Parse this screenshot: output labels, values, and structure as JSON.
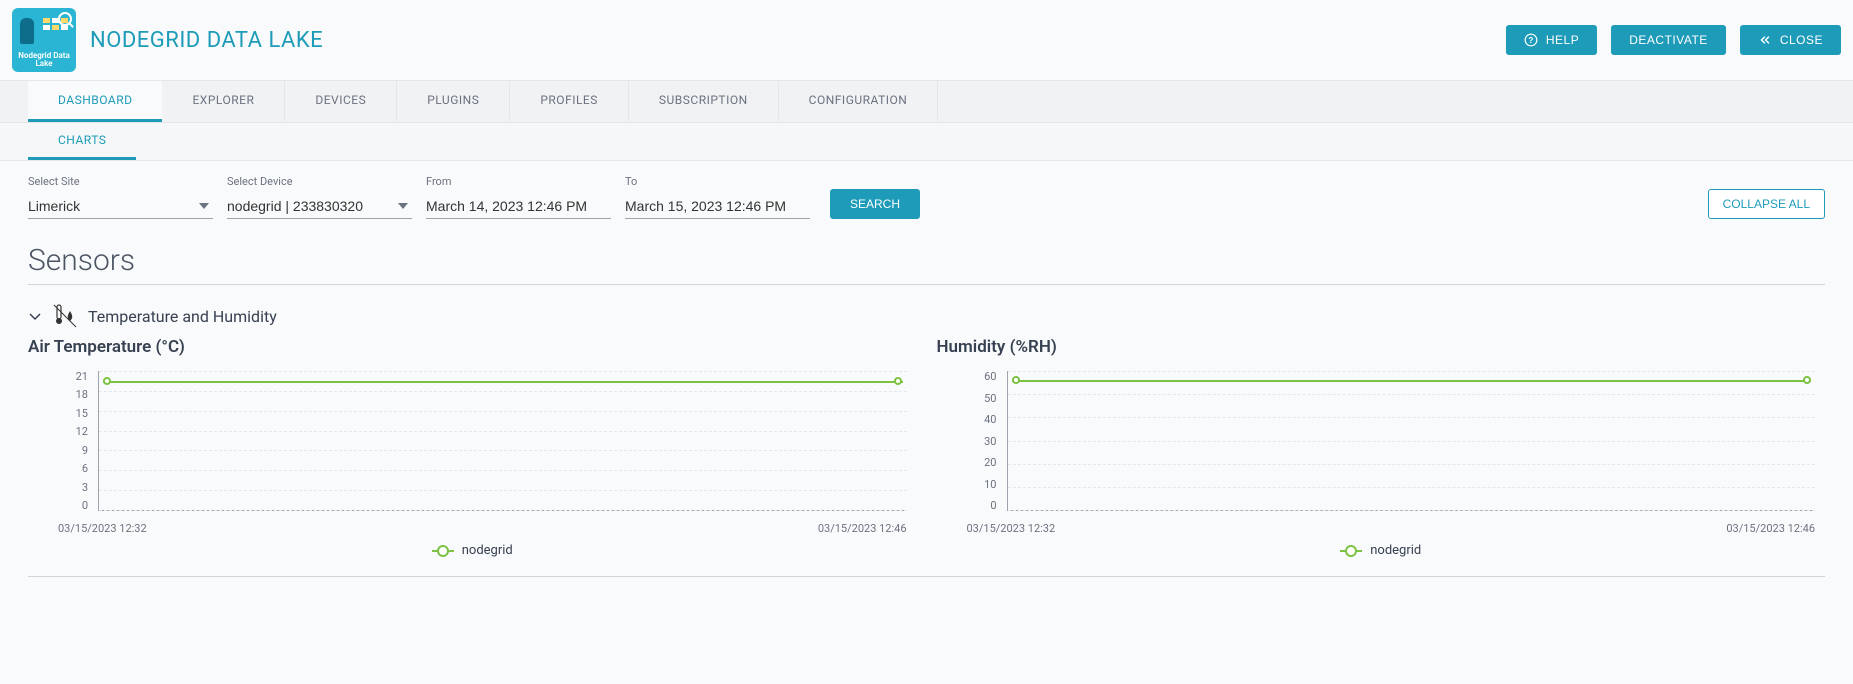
{
  "app": {
    "title": "NODEGRID DATA LAKE",
    "logo_text": "Nodegrid Data Lake"
  },
  "header_actions": {
    "help": "HELP",
    "deactivate": "DEACTIVATE",
    "close": "CLOSE"
  },
  "nav": {
    "tabs": [
      "DASHBOARD",
      "EXPLORER",
      "DEVICES",
      "PLUGINS",
      "PROFILES",
      "SUBSCRIPTION",
      "CONFIGURATION"
    ],
    "active": 0
  },
  "sub_nav": {
    "tabs": [
      "CHARTS"
    ],
    "active": 0
  },
  "filters": {
    "site_label": "Select Site",
    "site_value": "Limerick",
    "device_label": "Select Device",
    "device_value": "nodegrid | 233830320",
    "from_label": "From",
    "from_value": "March 14, 2023 12:46 PM",
    "to_label": "To",
    "to_value": "March 15, 2023 12:46 PM",
    "search": "SEARCH",
    "collapse_all": "COLLAPSE ALL"
  },
  "section": {
    "title": "Sensors"
  },
  "group": {
    "title": "Temperature and Humidity"
  },
  "chart_data": [
    {
      "type": "line",
      "title": "Air Temperature (°C)",
      "series": [
        {
          "name": "nodegrid",
          "values": [
            19.5,
            19.5
          ]
        }
      ],
      "x": [
        "03/15/2023 12:32",
        "03/15/2023 12:46"
      ],
      "y_ticks": [
        21,
        18,
        15,
        12,
        9,
        6,
        3,
        0
      ],
      "ylim": [
        0,
        21
      ],
      "xlabel": "",
      "ylabel": ""
    },
    {
      "type": "line",
      "title": "Humidity (%RH)",
      "series": [
        {
          "name": "nodegrid",
          "values": [
            56,
            56
          ]
        }
      ],
      "x": [
        "03/15/2023 12:32",
        "03/15/2023 12:46"
      ],
      "y_ticks": [
        60,
        50,
        40,
        30,
        20,
        10,
        0
      ],
      "ylim": [
        0,
        60
      ],
      "xlabel": "",
      "ylabel": ""
    }
  ]
}
